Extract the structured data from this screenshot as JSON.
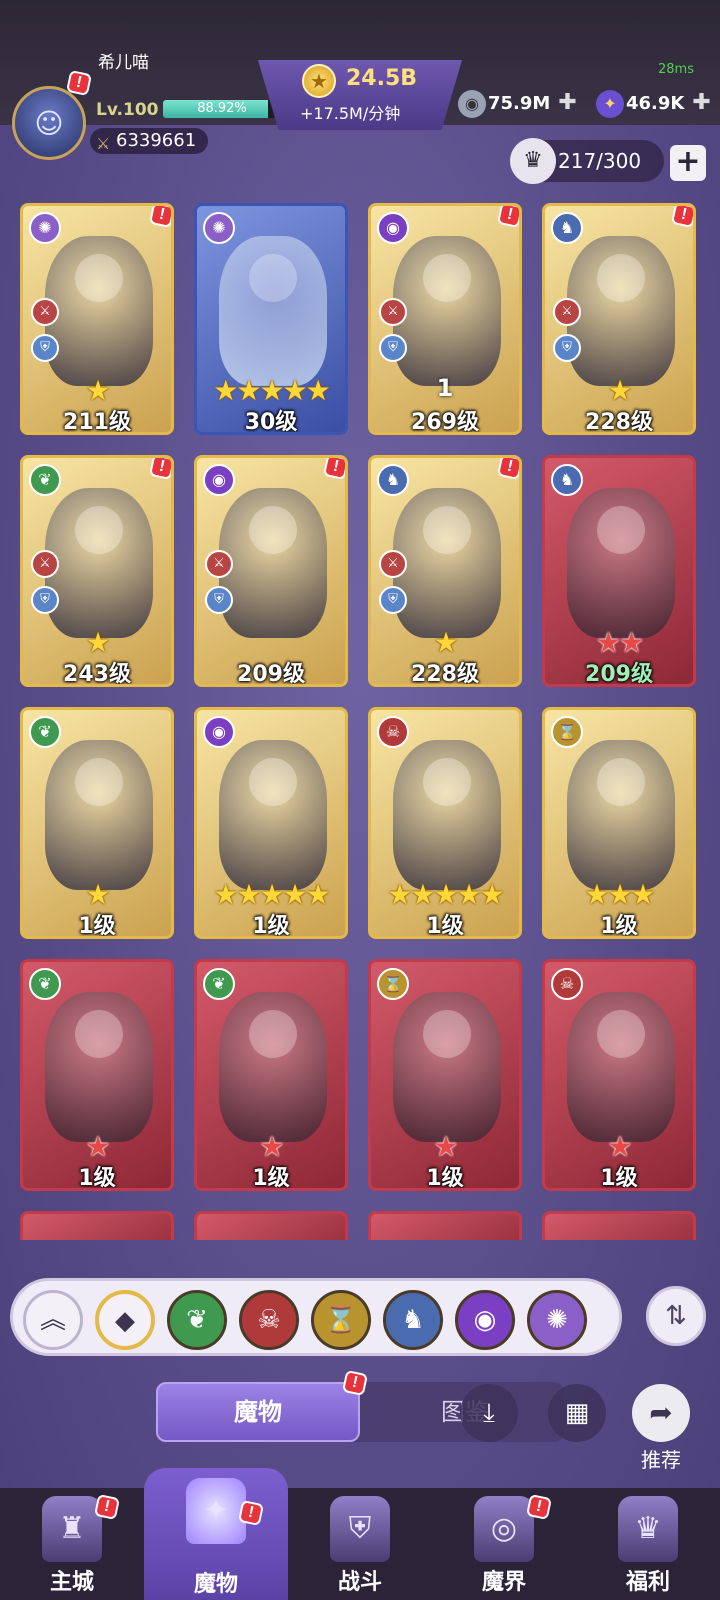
{
  "status": {
    "latency": "28ms"
  },
  "player": {
    "name": "希儿喵",
    "level": "Lv.100",
    "xp_text": "88.92%",
    "xp_fraction": 0.8892,
    "power": "6339661"
  },
  "currency": {
    "gold": "24.5B",
    "gold_rate": "+17.5M/分钟",
    "coins": "75.9M",
    "gems": "46.9K"
  },
  "capacity": {
    "text": "217/300"
  },
  "cards": [
    {
      "level": "211级",
      "stars": "★",
      "frame": "gold",
      "element": "swirl",
      "badge": "!"
    },
    {
      "level": "30级",
      "stars": "★★★★★",
      "frame": "blue",
      "element": "swirl",
      "badge": ""
    },
    {
      "level": "269级",
      "stars": "",
      "frame": "gold",
      "element": "eye",
      "badge": "!",
      "count": "1"
    },
    {
      "level": "228级",
      "stars": "★",
      "frame": "gold",
      "element": "dragon",
      "badge": "!"
    },
    {
      "level": "243级",
      "stars": "★",
      "frame": "gold",
      "element": "leaf",
      "badge": "!"
    },
    {
      "level": "209级",
      "stars": "",
      "frame": "gold",
      "element": "eye",
      "badge": "!"
    },
    {
      "level": "228级",
      "stars": "★",
      "frame": "gold",
      "element": "dragon",
      "badge": "!"
    },
    {
      "level": "209级",
      "stars": "★★",
      "frame": "red",
      "element": "dragon",
      "badge": ""
    },
    {
      "level": "1级",
      "stars": "★",
      "frame": "gold",
      "element": "leaf",
      "badge": ""
    },
    {
      "level": "1级",
      "stars": "★★★★★",
      "frame": "gold",
      "element": "eye",
      "badge": ""
    },
    {
      "level": "1级",
      "stars": "★★★★★",
      "frame": "gold",
      "element": "demon",
      "badge": ""
    },
    {
      "level": "1级",
      "stars": "★★★",
      "frame": "gold",
      "element": "hourglass",
      "badge": ""
    },
    {
      "level": "1级",
      "stars": "★",
      "frame": "red",
      "element": "leaf",
      "badge": ""
    },
    {
      "level": "1级",
      "stars": "★",
      "frame": "red",
      "element": "leaf",
      "badge": ""
    },
    {
      "level": "1级",
      "stars": "★",
      "frame": "red",
      "element": "hourglass",
      "badge": ""
    },
    {
      "level": "1级",
      "stars": "★",
      "frame": "red",
      "element": "demon",
      "badge": ""
    }
  ],
  "filters": [
    "collapse",
    "all",
    "leaf",
    "demon",
    "hourglass",
    "dragon",
    "eye",
    "swirl"
  ],
  "tabs": {
    "monsters": "魔物",
    "codex": "图鉴"
  },
  "recommend": "推荐",
  "nav": [
    {
      "label": "主城",
      "icon": "castle-icon"
    },
    {
      "label": "魔物",
      "icon": "flame-icon"
    },
    {
      "label": "战斗",
      "icon": "shield-sword-icon"
    },
    {
      "label": "魔界",
      "icon": "portal-icon"
    },
    {
      "label": "福利",
      "icon": "chest-icon"
    }
  ],
  "colors": {
    "accent": "#7558c5",
    "gold": "#e3b947",
    "red": "#c33b4a",
    "badge": "#e8323c"
  }
}
